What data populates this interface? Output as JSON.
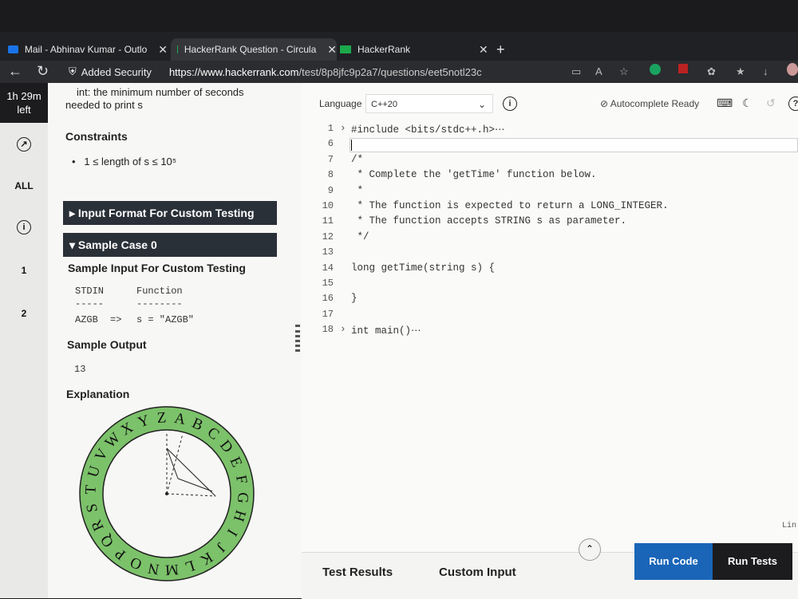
{
  "browser": {
    "tabs": [
      {
        "title": "Mail - Abhinav Kumar - Outlo",
        "icon": "outlook-icon"
      },
      {
        "title": "HackerRank Question - Circula",
        "icon": "hackerrank-icon"
      },
      {
        "title": "HackerRank",
        "icon": "hackerrank-icon"
      }
    ],
    "new_tab": "+",
    "security_label": "Added Security",
    "url_host": "https://www.hackerrank.com",
    "url_path": "/test/8p8jfc9p2a7/questions/eet5notl23c"
  },
  "sidebar": {
    "timer": [
      "1h 29m",
      "left"
    ],
    "items": [
      {
        "label": "",
        "icon": "clock-icon"
      },
      {
        "label": "ALL"
      },
      {
        "label": "i",
        "icon": "info-icon"
      },
      {
        "label": "1"
      },
      {
        "label": "2"
      }
    ]
  },
  "problem": {
    "return_line1": "int: the minimum number of seconds",
    "return_line2": "needed to print s",
    "constraints_title": "Constraints",
    "constraint_1": "1 ≤ length of s ≤ 10⁵",
    "input_format_bar": "▸ Input Format For Custom Testing",
    "sample_case_bar": "▾ Sample Case 0",
    "sample_input_title": "Sample Input For Custom Testing",
    "stdin_header": "STDIN",
    "function_header": "Function",
    "stdin_sep": "-----",
    "function_sep": "--------",
    "stdin_value": "AZGB",
    "arrow": "=>",
    "function_value": "s = \"AZGB\"",
    "sample_output_title": "Sample Output",
    "sample_output": "13",
    "explanation_title": "Explanation",
    "wheel_letters": [
      "A",
      "B",
      "C",
      "D",
      "E",
      "F",
      "G",
      "H",
      "I",
      "J",
      "K",
      "L",
      "M",
      "N",
      "O",
      "P",
      "Q",
      "R",
      "S",
      "T",
      "U",
      "V",
      "W",
      "X",
      "Y",
      "Z"
    ]
  },
  "editor": {
    "language_label": "Language",
    "language_value": "C++20",
    "autocomplete": "Autocomplete Ready",
    "lines": [
      {
        "n": "1",
        "fold": "›",
        "text": "#include <bits/stdc++.h>⋯"
      },
      {
        "n": "6",
        "fold": "",
        "text": ""
      },
      {
        "n": "7",
        "fold": "",
        "text": "/*"
      },
      {
        "n": "8",
        "fold": "",
        "text": " * Complete the 'getTime' function below."
      },
      {
        "n": "9",
        "fold": "",
        "text": " *"
      },
      {
        "n": "10",
        "fold": "",
        "text": " * The function is expected to return a LONG_INTEGER."
      },
      {
        "n": "11",
        "fold": "",
        "text": " * The function accepts STRING s as parameter."
      },
      {
        "n": "12",
        "fold": "",
        "text": " */"
      },
      {
        "n": "13",
        "fold": "",
        "text": ""
      },
      {
        "n": "14",
        "fold": "",
        "text": "long getTime(string s) {"
      },
      {
        "n": "15",
        "fold": "",
        "text": ""
      },
      {
        "n": "16",
        "fold": "",
        "text": "}"
      },
      {
        "n": "17",
        "fold": "",
        "text": ""
      },
      {
        "n": "18",
        "fold": "›",
        "text": "int main()⋯"
      }
    ],
    "line_col_hint": "Lin"
  },
  "bottom": {
    "test_results_tab": "Test Results",
    "custom_input_tab": "Custom Input",
    "run_code": "Run Code",
    "run_tests": "Run Tests"
  }
}
